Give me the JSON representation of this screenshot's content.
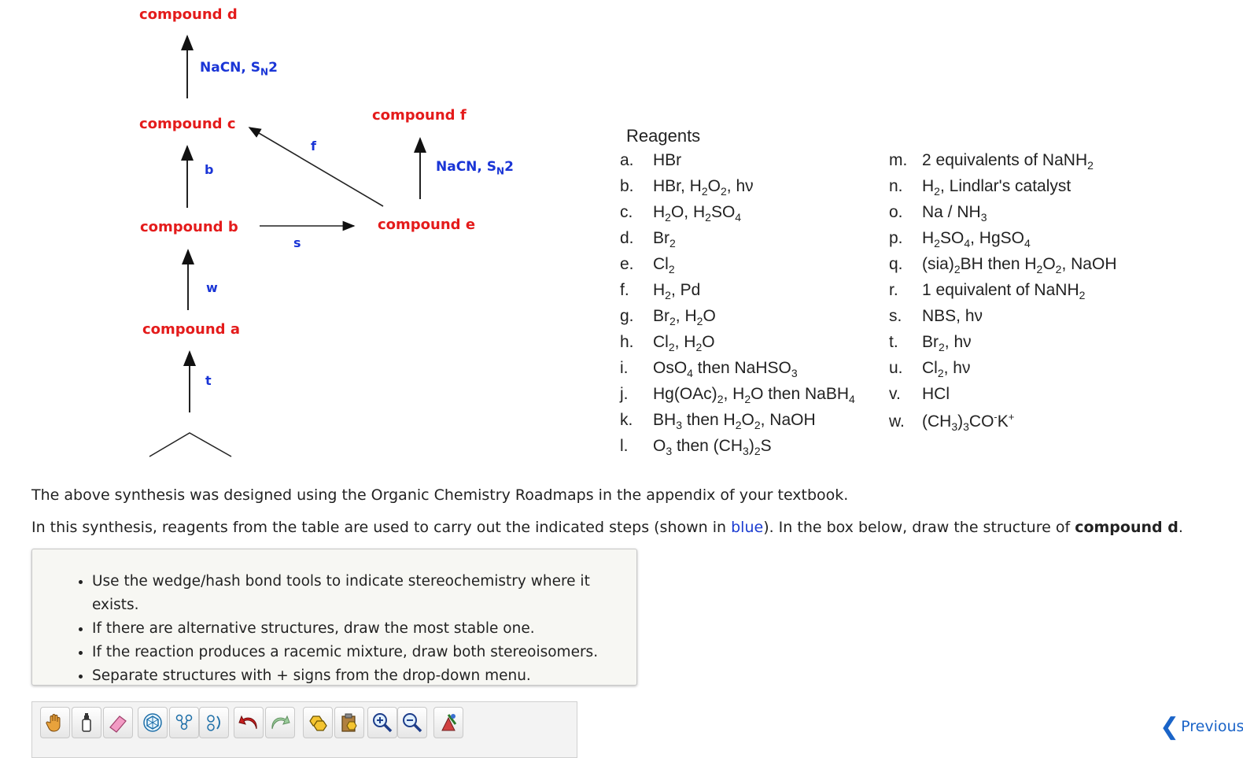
{
  "scheme": {
    "compounds": {
      "d": "compound d",
      "c": "compound c",
      "b": "compound b",
      "a": "compound a",
      "e": "compound e",
      "f": "compound f"
    },
    "steps": {
      "c_to_d": "NaCN, S",
      "c_to_d_sub": "N",
      "c_to_d_tail": "2",
      "e_to_f": "NaCN, S",
      "e_to_f_sub": "N",
      "e_to_f_tail": "2",
      "b_to_c": "b",
      "a_to_b": "w",
      "start_to_a": "t",
      "b_to_e": "s",
      "e_to_c": "f"
    }
  },
  "reagents": {
    "title": "Reagents",
    "left": [
      {
        "letter": "a.",
        "html": "HBr"
      },
      {
        "letter": "b.",
        "html": "HBr, H<sub>2</sub>O<sub>2</sub>, hν"
      },
      {
        "letter": "c.",
        "html": "H<sub>2</sub>O, H<sub>2</sub>SO<sub>4</sub>"
      },
      {
        "letter": "d.",
        "html": "Br<sub>2</sub>"
      },
      {
        "letter": "e.",
        "html": "Cl<sub>2</sub>"
      },
      {
        "letter": "f.",
        "html": "H<sub>2</sub>, Pd"
      },
      {
        "letter": "g.",
        "html": "Br<sub>2</sub>, H<sub>2</sub>O"
      },
      {
        "letter": "h.",
        "html": "Cl<sub>2</sub>, H<sub>2</sub>O"
      },
      {
        "letter": "i.",
        "html": "OsO<sub>4</sub> then NaHSO<sub>3</sub>"
      },
      {
        "letter": "j.",
        "html": "Hg(OAc)<sub>2</sub>, H<sub>2</sub>O then NaBH<sub>4</sub>"
      },
      {
        "letter": "k.",
        "html": "BH<sub>3</sub> then H<sub>2</sub>O<sub>2</sub>, NaOH"
      },
      {
        "letter": "l.",
        "html": "O<sub>3</sub> then (CH<sub>3</sub>)<sub>2</sub>S"
      }
    ],
    "right": [
      {
        "letter": "m.",
        "html": "2 equivalents of NaNH<sub>2</sub>"
      },
      {
        "letter": "n.",
        "html": "H<sub>2</sub>, Lindlar's catalyst"
      },
      {
        "letter": "o.",
        "html": "Na / NH<sub>3</sub>"
      },
      {
        "letter": "p.",
        "html": "H<sub>2</sub>SO<sub>4</sub>, HgSO<sub>4</sub>"
      },
      {
        "letter": "q.",
        "html": "(sia)<sub>2</sub>BH then H<sub>2</sub>O<sub>2</sub>, NaOH"
      },
      {
        "letter": "r.",
        "html": "1 equivalent of NaNH<sub>2</sub>"
      },
      {
        "letter": "s.",
        "html": "NBS, hν"
      },
      {
        "letter": "t.",
        "html": "Br<sub>2</sub>, hν"
      },
      {
        "letter": "u.",
        "html": "Cl<sub>2</sub>, hν"
      },
      {
        "letter": "v.",
        "html": "HCl"
      },
      {
        "letter": "w.",
        "html": "(CH<sub>3</sub>)<sub>3</sub>CO<sup>-</sup>K<sup>+</sup>"
      }
    ]
  },
  "text": {
    "p1": "The above synthesis was designed using the Organic Chemistry Roadmaps in the appendix of your textbook.",
    "p2_a": "In this synthesis, reagents from the table are used to carry out the indicated steps (shown in ",
    "p2_blue": "blue",
    "p2_b": "). In the box below, draw the structure of ",
    "p2_bold": "compound d",
    "p2_c": "."
  },
  "instructions": [
    "Use the wedge/hash bond tools to indicate stereochemistry where it exists.",
    "If there are alternative structures, draw the most stable one.",
    "If the reaction produces a racemic mixture, draw both stereoisomers.",
    "Separate structures with + signs from the drop-down menu."
  ],
  "toolbar": {
    "tools": [
      "hand-icon",
      "bottle-icon",
      "eraser-icon",
      "ring-template-icon",
      "chain-icon",
      "rotate-icon",
      "undo-icon",
      "redo-icon",
      "copy-icon",
      "paste-icon",
      "zoom-in-icon",
      "zoom-out-icon",
      "clean-icon"
    ]
  },
  "nav": {
    "previous": "Previous"
  },
  "colors": {
    "compound": "#e41b1b",
    "reagent": "#1a35d6",
    "link": "#1a64c8"
  }
}
